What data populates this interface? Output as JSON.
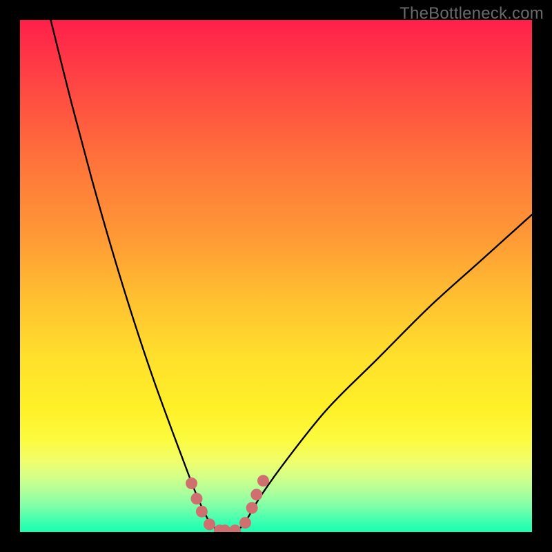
{
  "attribution": "TheBottleneck.com",
  "chart_data": {
    "type": "line",
    "title": "",
    "xlabel": "",
    "ylabel": "",
    "xlim": [
      0,
      100
    ],
    "ylim": [
      0,
      100
    ],
    "grid": false,
    "legend": false,
    "annotations": [],
    "series": [
      {
        "name": "bottleneck-curve",
        "x": [
          6,
          10,
          14,
          18,
          22,
          26,
          30,
          33,
          35,
          37,
          39,
          40,
          42,
          44,
          47,
          52,
          60,
          70,
          80,
          90,
          100
        ],
        "values": [
          100,
          84,
          69,
          55,
          42,
          30,
          19,
          11,
          6,
          2,
          0,
          0,
          0,
          2,
          7,
          14,
          24,
          34,
          44,
          53,
          62
        ]
      }
    ],
    "highlight": {
      "name": "bottom-highlight",
      "color": "#cf6f70",
      "points_x": [
        33.5,
        34.5,
        35.5,
        37,
        39,
        40,
        42,
        44,
        45.3,
        46.2,
        47.5
      ],
      "points_y": [
        9.5,
        6.5,
        4,
        1.5,
        0.3,
        0.3,
        0.3,
        1.8,
        4.7,
        7.3,
        10
      ]
    }
  }
}
